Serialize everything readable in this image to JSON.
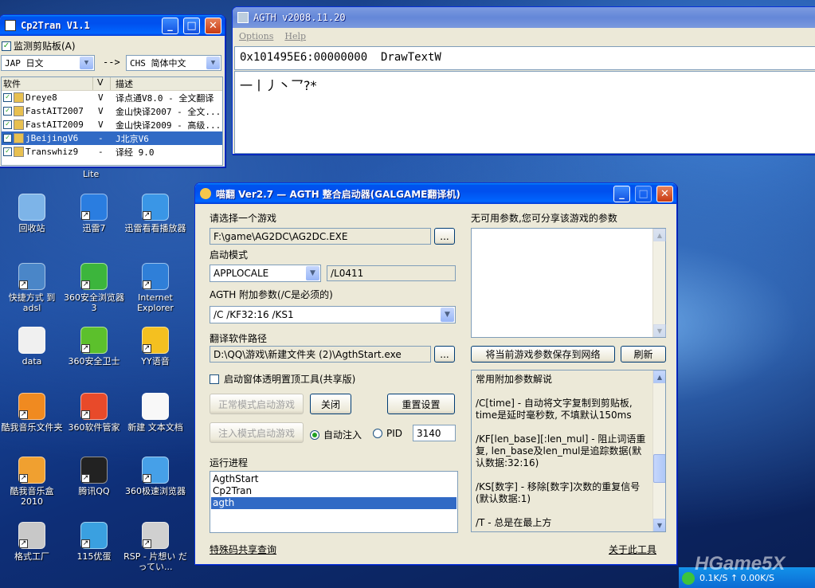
{
  "desktop": {
    "icons": [
      {
        "label": "回收站",
        "color": "#7db4e8"
      },
      {
        "label": "迅雷7",
        "color": "#2a7de0"
      },
      {
        "label": "迅雷看看播放器",
        "color": "#3a96e6"
      },
      {
        "label": "快捷方式 到 adsl",
        "color": "#4a86c8"
      },
      {
        "label": "360安全浏览器 3",
        "color": "#3cb53c"
      },
      {
        "label": "Internet Explorer",
        "color": "#2f7fd8"
      },
      {
        "label": "data",
        "color": "#f0f0f0"
      },
      {
        "label": "360安全卫士",
        "color": "#5cc02c"
      },
      {
        "label": "YY语音",
        "color": "#f4c020"
      },
      {
        "label": "酷我音乐文件夹",
        "color": "#f08a20"
      },
      {
        "label": "360软件管家",
        "color": "#e84a2a"
      },
      {
        "label": "新建 文本文档",
        "color": "#f8f8f8"
      },
      {
        "label": "酷我音乐盒2010",
        "color": "#f0a030"
      },
      {
        "label": "腾讯QQ",
        "color": "#222222"
      },
      {
        "label": "360极速浏览器",
        "color": "#46a0e8"
      },
      {
        "label": "格式工厂",
        "color": "#c8c8c8"
      },
      {
        "label": "115优蛋",
        "color": "#3aa0e0"
      },
      {
        "label": "RSP - 片想い だってい...",
        "color": "#d0d0d0"
      }
    ],
    "partial_label": "Lite",
    "tray_text": "0.1K/S ↑ 0.00K/S",
    "watermark": "HGame5X"
  },
  "agth": {
    "title": "AGTH v2008.11.20",
    "menu": [
      "Options",
      "Help"
    ],
    "hook_address": "0x101495E6:00000000  DrawTextW",
    "text_content": "一丨丿丶乛?*"
  },
  "cp2tran": {
    "title": "Cp2Tran V1.1",
    "monitor_label": "监测剪贴板(A)",
    "source_lang": "JAP 日文",
    "arrow": "-->",
    "target_lang": "CHS 简体中文",
    "columns": [
      "软件",
      "V",
      "描述"
    ],
    "rows": [
      {
        "name": "Dreye8",
        "v": "V",
        "desc": "译点通V8.0 - 全文翻译",
        "selected": false
      },
      {
        "name": "FastAIT2007",
        "v": "V",
        "desc": "金山快译2007 - 全文...",
        "selected": false
      },
      {
        "name": "FastAIT2009",
        "v": "V",
        "desc": "金山快译2009 - 高级...",
        "selected": false
      },
      {
        "name": "jBeijingV6",
        "v": "-",
        "desc": "J北京V6",
        "selected": true
      },
      {
        "name": "Transwhiz9",
        "v": "-",
        "desc": "译经 9.0",
        "selected": false
      }
    ]
  },
  "launcher": {
    "title": "喵翻 Ver2.7 — AGTH 整合启动器(GALGAME翻译机)",
    "select_game_label": "请选择一个游戏",
    "game_path": "F:\\game\\AG2DC\\AG2DC.EXE",
    "browse": "...",
    "mode_label": "启动模式",
    "mode_value": "APPLOCALE",
    "locale_value": "/L0411",
    "agth_params_label": "AGTH 附加参数(/C是必须的)",
    "agth_params_value": "/C /KF32:16 /KS1",
    "translator_path_label": "翻译软件路径",
    "translator_path": "D:\\QQ\\游戏\\新建文件夹 (2)\\AgthStart.exe",
    "transparent_tool_label": "启动窗体透明置顶工具(共享版)",
    "normal_launch": "正常模式启动游戏",
    "close": "关闭",
    "reset": "重置设置",
    "inject_launch": "注入模式启动游戏",
    "auto_inject": "自动注入",
    "pid_label": "PID",
    "pid_value": "3140",
    "processes_label": "运行进程",
    "processes": [
      {
        "name": "AgthStart",
        "selected": false
      },
      {
        "name": "Cp2Tran",
        "selected": false
      },
      {
        "name": "agth",
        "selected": true
      }
    ],
    "special_code_link": "特殊码共享查询",
    "no_params_label": "无可用参数,您可分享该游戏的参数",
    "save_params": "将当前游戏参数保存到网络",
    "refresh": "刷新",
    "help_text": [
      "常用附加参数解说",
      "",
      "/C[time] - 自动将文字复制到剪贴板, time是延时毫秒数, 不填默认150ms",
      "",
      "/KF[len_base][:len_mul] - 阻止词语重复, len_base及len_mul是追踪数据(默认数据:32:16)",
      "",
      "/KS[数字] - 移除[数字]次数的重复信号(默认数据:1)",
      "",
      "/T - 总是在最上方"
    ],
    "about_link": "关于此工具"
  }
}
